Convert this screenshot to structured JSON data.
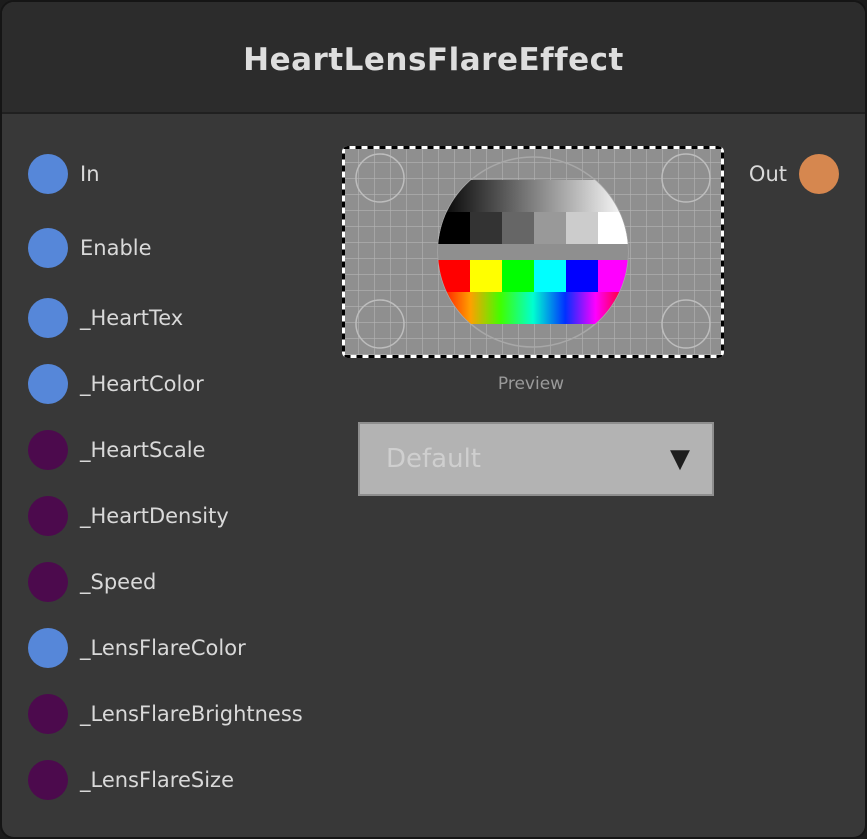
{
  "node": {
    "title": "HeartLensFlareEffect"
  },
  "inputs": [
    {
      "label": "In",
      "color": "#5687d9"
    },
    {
      "label": "Enable",
      "color": "#5687d9"
    },
    {
      "label": "_HeartTex",
      "color": "#5687d9"
    },
    {
      "label": "_HeartColor",
      "color": "#5687d9"
    },
    {
      "label": "_HeartScale",
      "color": "#4c0a4d"
    },
    {
      "label": "_HeartDensity",
      "color": "#4c0a4d"
    },
    {
      "label": "_Speed",
      "color": "#4c0a4d"
    },
    {
      "label": "_LensFlareColor",
      "color": "#5687d9"
    },
    {
      "label": "_LensFlareBrightness",
      "color": "#4c0a4d"
    },
    {
      "label": "_LensFlareSize",
      "color": "#4c0a4d"
    }
  ],
  "outputs": [
    {
      "label": "Out",
      "color": "#d6874f"
    }
  ],
  "preview": {
    "caption": "Preview"
  },
  "dropdown": {
    "selected": "Default",
    "arrow_icon": "triangle-down-icon"
  }
}
